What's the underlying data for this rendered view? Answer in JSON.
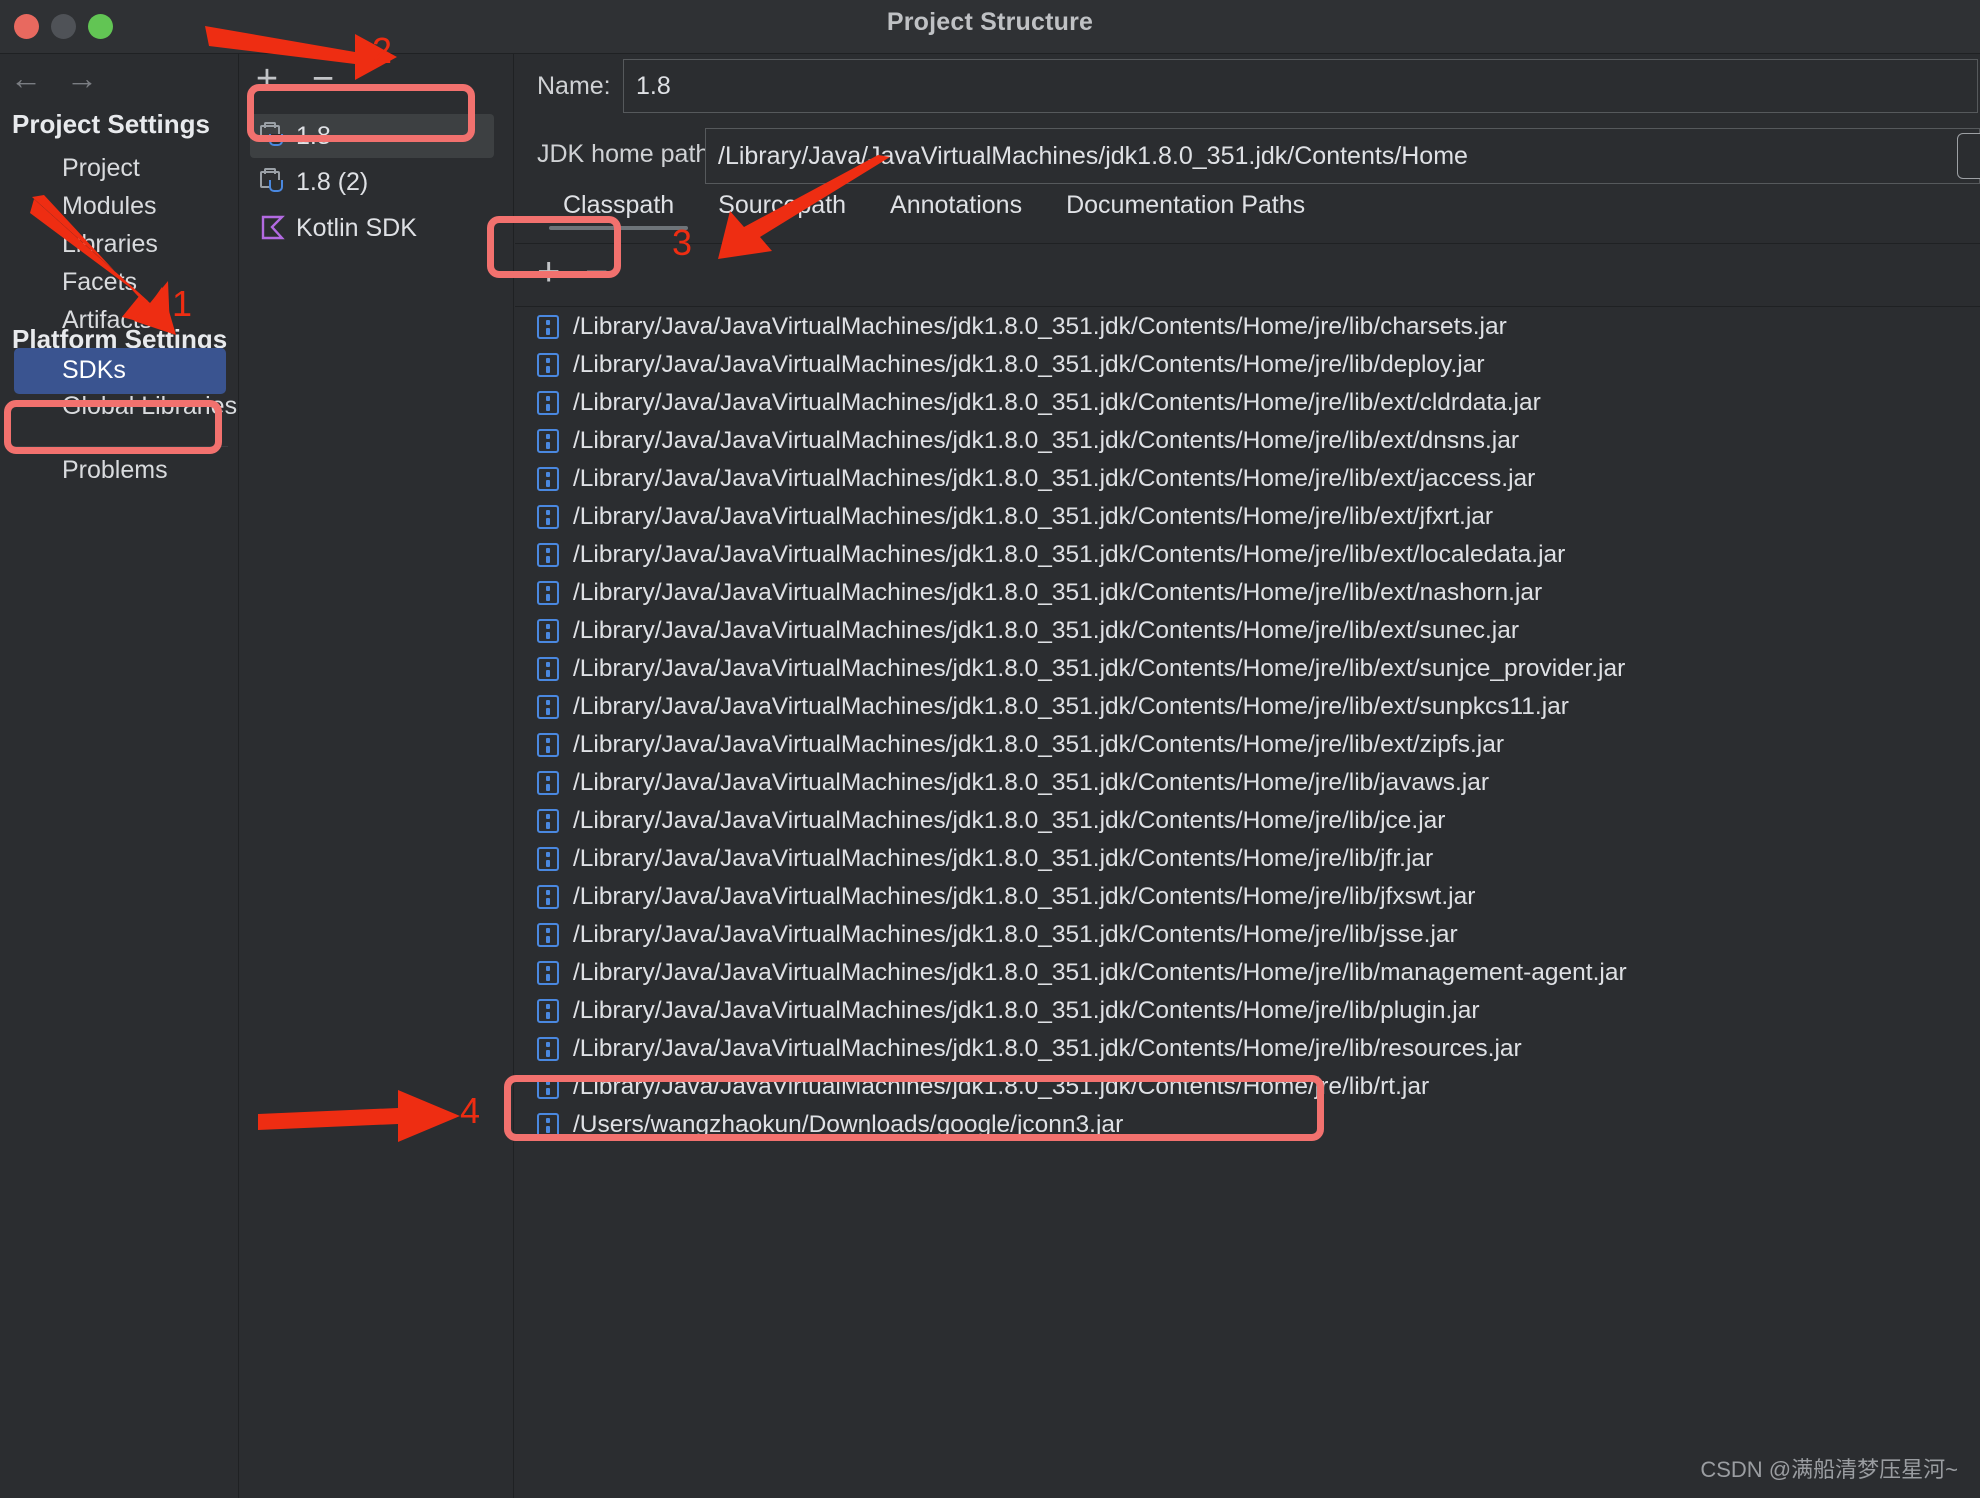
{
  "window": {
    "title": "Project Structure",
    "traffic_lights": [
      "close-red",
      "minimize-yellow",
      "maximize-green"
    ]
  },
  "sidebar": {
    "back_icon": "←",
    "forward_icon": "→",
    "sections": [
      {
        "title": "Project Settings",
        "items": [
          {
            "label": "Project",
            "selected": false
          },
          {
            "label": "Modules",
            "selected": false
          },
          {
            "label": "Libraries",
            "selected": false
          },
          {
            "label": "Facets",
            "selected": false
          },
          {
            "label": "Artifacts",
            "selected": false
          }
        ]
      },
      {
        "title": "Platform Settings",
        "items": [
          {
            "label": "SDKs",
            "selected": true
          },
          {
            "label": "Global Libraries",
            "selected": false
          }
        ]
      }
    ],
    "footer_item": {
      "label": "Problems"
    }
  },
  "sdk_pane": {
    "add_label": "+",
    "remove_label": "−",
    "items": [
      {
        "label": "1.8",
        "icon": "jdk-icon",
        "selected": true
      },
      {
        "label": "1.8 (2)",
        "icon": "jdk-icon",
        "selected": false
      },
      {
        "label": "Kotlin SDK",
        "icon": "kotlin-icon",
        "selected": false
      }
    ]
  },
  "detail": {
    "name_label": "Name:",
    "name_value": "1.8",
    "jdk_home_label": "JDK home path:",
    "jdk_home_value": "/Library/Java/JavaVirtualMachines/jdk1.8.0_351.jdk/Contents/Home",
    "tabs": [
      {
        "label": "Classpath",
        "active": true
      },
      {
        "label": "Sourcepath",
        "active": false
      },
      {
        "label": "Annotations",
        "active": false
      },
      {
        "label": "Documentation Paths",
        "active": false
      }
    ],
    "list_toolbar": {
      "add_label": "+",
      "remove_label": "−"
    },
    "classpath_entries": [
      "/Library/Java/JavaVirtualMachines/jdk1.8.0_351.jdk/Contents/Home/jre/lib/charsets.jar",
      "/Library/Java/JavaVirtualMachines/jdk1.8.0_351.jdk/Contents/Home/jre/lib/deploy.jar",
      "/Library/Java/JavaVirtualMachines/jdk1.8.0_351.jdk/Contents/Home/jre/lib/ext/cldrdata.jar",
      "/Library/Java/JavaVirtualMachines/jdk1.8.0_351.jdk/Contents/Home/jre/lib/ext/dnsns.jar",
      "/Library/Java/JavaVirtualMachines/jdk1.8.0_351.jdk/Contents/Home/jre/lib/ext/jaccess.jar",
      "/Library/Java/JavaVirtualMachines/jdk1.8.0_351.jdk/Contents/Home/jre/lib/ext/jfxrt.jar",
      "/Library/Java/JavaVirtualMachines/jdk1.8.0_351.jdk/Contents/Home/jre/lib/ext/localedata.jar",
      "/Library/Java/JavaVirtualMachines/jdk1.8.0_351.jdk/Contents/Home/jre/lib/ext/nashorn.jar",
      "/Library/Java/JavaVirtualMachines/jdk1.8.0_351.jdk/Contents/Home/jre/lib/ext/sunec.jar",
      "/Library/Java/JavaVirtualMachines/jdk1.8.0_351.jdk/Contents/Home/jre/lib/ext/sunjce_provider.jar",
      "/Library/Java/JavaVirtualMachines/jdk1.8.0_351.jdk/Contents/Home/jre/lib/ext/sunpkcs11.jar",
      "/Library/Java/JavaVirtualMachines/jdk1.8.0_351.jdk/Contents/Home/jre/lib/ext/zipfs.jar",
      "/Library/Java/JavaVirtualMachines/jdk1.8.0_351.jdk/Contents/Home/jre/lib/javaws.jar",
      "/Library/Java/JavaVirtualMachines/jdk1.8.0_351.jdk/Contents/Home/jre/lib/jce.jar",
      "/Library/Java/JavaVirtualMachines/jdk1.8.0_351.jdk/Contents/Home/jre/lib/jfr.jar",
      "/Library/Java/JavaVirtualMachines/jdk1.8.0_351.jdk/Contents/Home/jre/lib/jfxswt.jar",
      "/Library/Java/JavaVirtualMachines/jdk1.8.0_351.jdk/Contents/Home/jre/lib/jsse.jar",
      "/Library/Java/JavaVirtualMachines/jdk1.8.0_351.jdk/Contents/Home/jre/lib/management-agent.jar",
      "/Library/Java/JavaVirtualMachines/jdk1.8.0_351.jdk/Contents/Home/jre/lib/plugin.jar",
      "/Library/Java/JavaVirtualMachines/jdk1.8.0_351.jdk/Contents/Home/jre/lib/resources.jar",
      "/Library/Java/JavaVirtualMachines/jdk1.8.0_351.jdk/Contents/Home/jre/lib/rt.jar",
      "/Users/wangzhaokun/Downloads/google/jconn3.jar"
    ]
  },
  "annotations": {
    "color": "#ee2d12",
    "box_color": "#f2716e",
    "steps": [
      {
        "number": "1",
        "target": "sdks-sidebar-item"
      },
      {
        "number": "2",
        "target": "sdk-add-button"
      },
      {
        "number": "3",
        "target": "classpath-add-button"
      },
      {
        "number": "4",
        "target": "jconn3-classpath-row"
      }
    ]
  },
  "watermark": {
    "text": "CSDN @满船清梦压星河~"
  }
}
